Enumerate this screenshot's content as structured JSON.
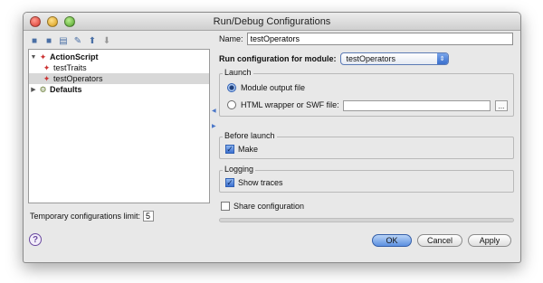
{
  "window": {
    "title": "Run/Debug Configurations"
  },
  "toolbar": {
    "icons": [
      "add-config-icon",
      "remove-config-icon",
      "copy-config-icon",
      "edit-defaults-icon",
      "move-up-icon",
      "move-down-icon"
    ]
  },
  "tree": {
    "items": [
      {
        "label": "ActionScript",
        "bold": true,
        "expanded": true
      },
      {
        "label": "testTraits"
      },
      {
        "label": "testOperators",
        "selected": true
      },
      {
        "label": "Defaults",
        "bold": true,
        "expanded": false
      }
    ]
  },
  "temp_limit": {
    "label": "Temporary configurations limit:",
    "value": "5"
  },
  "form": {
    "name_label": "Name:",
    "name_value": "testOperators",
    "module_label": "Run configuration for module:",
    "module_value": "testOperators",
    "launch": {
      "title": "Launch",
      "option1": "Module output file",
      "option2": "HTML wrapper or SWF file:",
      "browse": "..."
    },
    "before_launch": {
      "title": "Before launch",
      "make": "Make"
    },
    "logging": {
      "title": "Logging",
      "show_traces": "Show traces"
    },
    "share": "Share configuration"
  },
  "footer": {
    "help": "?",
    "ok": "OK",
    "cancel": "Cancel",
    "apply": "Apply"
  },
  "colors": {
    "accent": "#3a6fcd",
    "window_bg": "#e8e8e8"
  }
}
